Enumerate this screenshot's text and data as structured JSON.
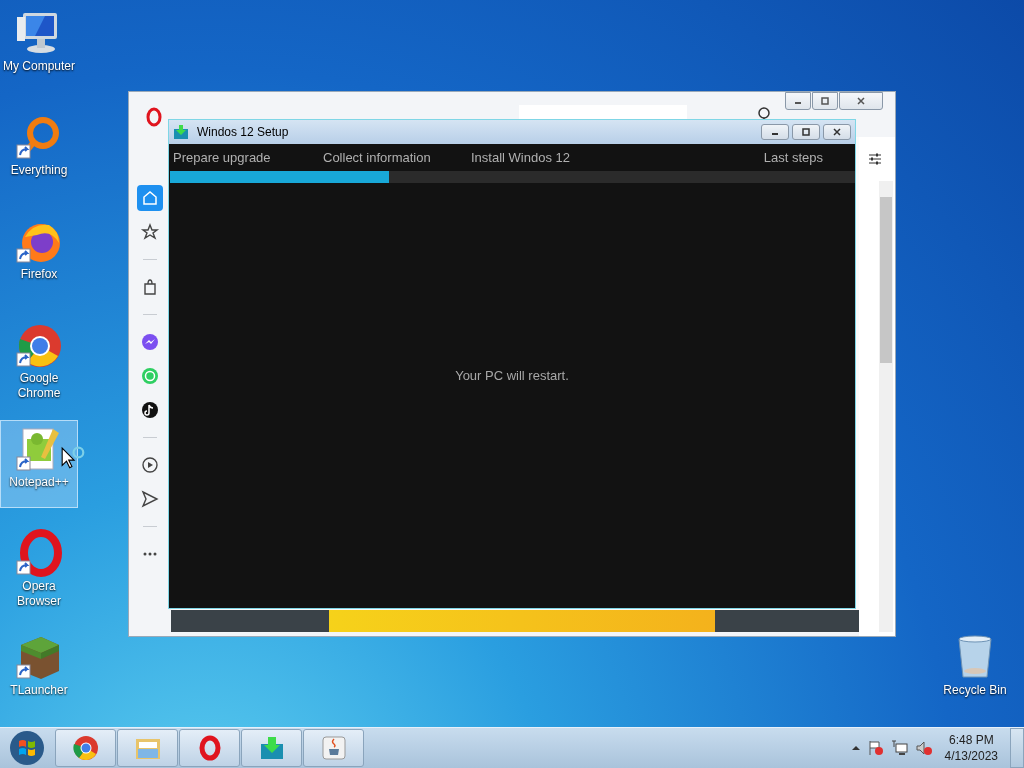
{
  "desktop_icons": [
    {
      "label": "My Computer",
      "kind": "computer",
      "shortcut": false,
      "selected": false
    },
    {
      "label": "Everything",
      "kind": "ring",
      "shortcut": true,
      "selected": false
    },
    {
      "label": "Firefox",
      "kind": "fox",
      "shortcut": true,
      "selected": false
    },
    {
      "label": "Google Chrome",
      "kind": "chrome",
      "shortcut": true,
      "selected": false
    },
    {
      "label": "Notepad++",
      "kind": "notepad",
      "shortcut": true,
      "selected": true
    },
    {
      "label": "Opera Browser",
      "kind": "opera",
      "shortcut": true,
      "selected": false
    },
    {
      "label": "TLauncher",
      "kind": "block",
      "shortcut": true,
      "selected": false
    }
  ],
  "recycle_bin": {
    "label": "Recycle Bin"
  },
  "browser": {
    "sidebar_items": [
      {
        "kind": "home",
        "selected": true
      },
      {
        "kind": "star",
        "selected": false
      },
      {
        "kind": "bag",
        "selected": false
      },
      {
        "kind": "messenger",
        "selected": false
      },
      {
        "kind": "whatsapp",
        "selected": false
      },
      {
        "kind": "tiktok",
        "selected": false
      },
      {
        "kind": "play",
        "selected": false
      },
      {
        "kind": "send",
        "selected": false
      },
      {
        "kind": "more",
        "selected": false
      }
    ]
  },
  "setup": {
    "title": "Windos 12 Setup",
    "steps": [
      {
        "label": "Prepare upgrade"
      },
      {
        "label": "Collect information"
      },
      {
        "label": "Install Windos 12"
      },
      {
        "label": "Last steps"
      }
    ],
    "progress": {
      "level": 0.32
    },
    "message": "Your PC will restart."
  },
  "taskbar": {
    "apps": [
      {
        "kind": "chrome"
      },
      {
        "kind": "folder"
      },
      {
        "kind": "opera"
      },
      {
        "kind": "download"
      },
      {
        "kind": "java"
      }
    ],
    "time": "6:48 PM",
    "date": "4/13/2023"
  }
}
